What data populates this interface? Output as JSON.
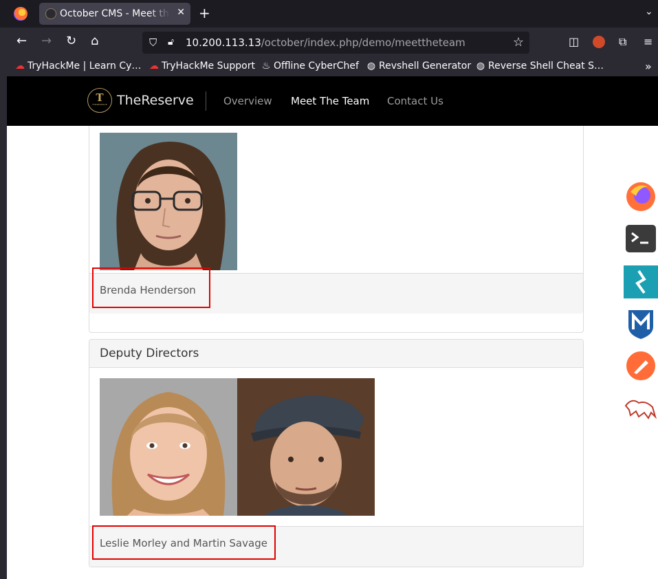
{
  "browser": {
    "tab_title": "October CMS - Meet the Team",
    "new_tab_icon": "+",
    "url_host": "10.200.113.13",
    "url_path": "/october/index.php/demo/meettheteam"
  },
  "bookmarks": [
    {
      "label": "TryHackMe | Learn Cy…",
      "icon": "tryhackme-icon"
    },
    {
      "label": "TryHackMe Support",
      "icon": "tryhackme-icon"
    },
    {
      "label": "Offline CyberChef",
      "icon": "chef-hat-icon"
    },
    {
      "label": "Revshell Generator",
      "icon": "globe-icon"
    },
    {
      "label": "Reverse Shell Cheat S…",
      "icon": "globe-icon"
    }
  ],
  "site": {
    "logo_letter": "T",
    "logo_small": "THERESERVE",
    "brand": "TheReserve",
    "nav": [
      {
        "label": "Overview",
        "active": false
      },
      {
        "label": "Meet The Team",
        "active": true
      },
      {
        "label": "Contact Us",
        "active": false
      }
    ]
  },
  "panels": [
    {
      "title": "",
      "footer": "Brenda Henderson",
      "photos": [
        "brenda-henderson-photo"
      ]
    },
    {
      "title": "Deputy Directors",
      "footer": "Leslie Morley and Martin Savage",
      "photos": [
        "leslie-morley-photo",
        "martin-savage-photo"
      ]
    }
  ],
  "dock": [
    "firefox-icon",
    "terminal-icon",
    "burp-icon",
    "metasploit-icon",
    "postman-icon",
    "kali-dragon-icon"
  ],
  "colors": {
    "highlight": "#e00000",
    "header_bg": "#000000",
    "browser_bg": "#1c1b22"
  }
}
